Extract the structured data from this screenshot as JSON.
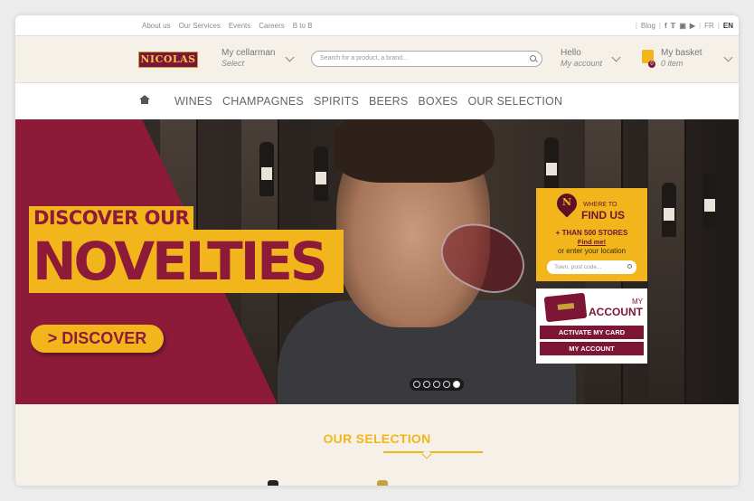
{
  "topbar": {
    "links": [
      "About us",
      "Our Services",
      "Events",
      "Careers",
      "B to B"
    ],
    "blog": "Blog",
    "social": [
      "f",
      "t",
      "ig",
      "yt"
    ],
    "lang_fr": "FR",
    "lang_en": "EN"
  },
  "header": {
    "logo": "NICOLAS",
    "cellarman_label": "My cellarman",
    "cellarman_value": "Select",
    "search_placeholder": "Search for a product, a brand...",
    "hello_label": "Hello",
    "account_label": "My account",
    "basket_label": "My basket",
    "basket_value": "0 item",
    "basket_count": "0"
  },
  "nav": {
    "items": [
      "WINES",
      "CHAMPAGNES",
      "SPIRITS",
      "BEERS",
      "BOXES",
      "OUR SELECTION"
    ]
  },
  "hero": {
    "line1": "DISCOVER OUR",
    "line2": "NOVELTIES",
    "button": "> DISCOVER",
    "slides": 5,
    "active_slide": 5
  },
  "findus": {
    "pin_letter": "N",
    "where": "WHERE TO",
    "title": "FIND US",
    "stores": "+ THAN 500 STORES",
    "findme": "Find me!",
    "or_enter": "or enter your location",
    "placeholder": "Town, post code..."
  },
  "account": {
    "my": "MY",
    "title": "ACCOUNT",
    "activate": "ACTIVATE MY CARD",
    "myaccount": "MY ACCOUNT"
  },
  "selection": {
    "title": "OUR SELECTION"
  },
  "colors": {
    "burgundy": "#8e1a3a",
    "gold": "#f2b51c",
    "cream": "#f5f1e8"
  }
}
